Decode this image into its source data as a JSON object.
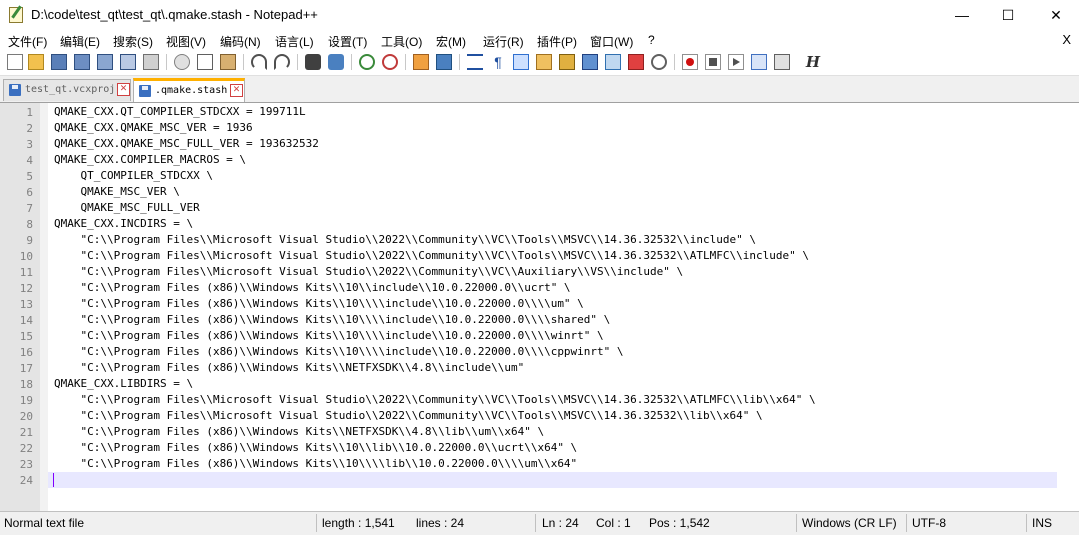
{
  "window": {
    "title": "D:\\code\\test_qt\\test_qt\\.qmake.stash - Notepad++",
    "minimize": "—",
    "maximize": "☐",
    "close": "✕"
  },
  "menu": {
    "items": [
      "文件(F)",
      "编辑(E)",
      "搜索(S)",
      "视图(V)",
      "编码(N)",
      "语言(L)",
      "设置(T)",
      "工具(O)",
      "宏(M)",
      "运行(R)",
      "插件(P)",
      "窗口(W)",
      "?"
    ],
    "close_doc": "X"
  },
  "toolbar": {
    "icons": [
      "new-file-icon",
      "open-file-icon",
      "save-icon",
      "save-all-icon",
      "close-icon",
      "close-all-icon",
      "print-icon",
      "cut-icon",
      "copy-icon",
      "paste-icon",
      "undo-icon",
      "redo-icon",
      "find-icon",
      "replace-icon",
      "zoom-in-icon",
      "zoom-out-icon",
      "sync-vertical-icon",
      "sync-horizontal-icon",
      "word-wrap-icon",
      "show-all-chars-icon",
      "indent-guide-icon",
      "doc-map-icon",
      "function-list-icon",
      "folder-workspace-icon",
      "doc-switcher-icon",
      "monitoring-icon",
      "record-macro-icon",
      "stop-macro-icon",
      "play-macro-icon",
      "run-macro-multiple-icon",
      "save-macro-icon",
      "history-icon"
    ]
  },
  "tabs": [
    {
      "label": "test_qt.vcxproj",
      "active": false
    },
    {
      "label": ".qmake.stash",
      "active": true
    }
  ],
  "editor": {
    "lines": [
      "QMAKE_CXX.QT_COMPILER_STDCXX = 199711L",
      "QMAKE_CXX.QMAKE_MSC_VER = 1936",
      "QMAKE_CXX.QMAKE_MSC_FULL_VER = 193632532",
      "QMAKE_CXX.COMPILER_MACROS = \\",
      "    QT_COMPILER_STDCXX \\",
      "    QMAKE_MSC_VER \\",
      "    QMAKE_MSC_FULL_VER",
      "QMAKE_CXX.INCDIRS = \\",
      "    \"C:\\\\Program Files\\\\Microsoft Visual Studio\\\\2022\\\\Community\\\\VC\\\\Tools\\\\MSVC\\\\14.36.32532\\\\include\" \\",
      "    \"C:\\\\Program Files\\\\Microsoft Visual Studio\\\\2022\\\\Community\\\\VC\\\\Tools\\\\MSVC\\\\14.36.32532\\\\ATLMFC\\\\include\" \\",
      "    \"C:\\\\Program Files\\\\Microsoft Visual Studio\\\\2022\\\\Community\\\\VC\\\\Auxiliary\\\\VS\\\\include\" \\",
      "    \"C:\\\\Program Files (x86)\\\\Windows Kits\\\\10\\\\include\\\\10.0.22000.0\\\\ucrt\" \\",
      "    \"C:\\\\Program Files (x86)\\\\Windows Kits\\\\10\\\\\\\\include\\\\10.0.22000.0\\\\\\\\um\" \\",
      "    \"C:\\\\Program Files (x86)\\\\Windows Kits\\\\10\\\\\\\\include\\\\10.0.22000.0\\\\\\\\shared\" \\",
      "    \"C:\\\\Program Files (x86)\\\\Windows Kits\\\\10\\\\\\\\include\\\\10.0.22000.0\\\\\\\\winrt\" \\",
      "    \"C:\\\\Program Files (x86)\\\\Windows Kits\\\\10\\\\\\\\include\\\\10.0.22000.0\\\\\\\\cppwinrt\" \\",
      "    \"C:\\\\Program Files (x86)\\\\Windows Kits\\\\NETFXSDK\\\\4.8\\\\include\\\\um\"",
      "QMAKE_CXX.LIBDIRS = \\",
      "    \"C:\\\\Program Files\\\\Microsoft Visual Studio\\\\2022\\\\Community\\\\VC\\\\Tools\\\\MSVC\\\\14.36.32532\\\\ATLMFC\\\\lib\\\\x64\" \\",
      "    \"C:\\\\Program Files\\\\Microsoft Visual Studio\\\\2022\\\\Community\\\\VC\\\\Tools\\\\MSVC\\\\14.36.32532\\\\lib\\\\x64\" \\",
      "    \"C:\\\\Program Files (x86)\\\\Windows Kits\\\\NETFXSDK\\\\4.8\\\\lib\\\\um\\\\x64\" \\",
      "    \"C:\\\\Program Files (x86)\\\\Windows Kits\\\\10\\\\lib\\\\10.0.22000.0\\\\ucrt\\\\x64\" \\",
      "    \"C:\\\\Program Files (x86)\\\\Windows Kits\\\\10\\\\\\\\lib\\\\10.0.22000.0\\\\\\\\um\\\\x64\"",
      ""
    ],
    "current_line": 24
  },
  "status": {
    "file_type": "Normal text file",
    "length": "length : 1,541",
    "lines": "lines : 24",
    "ln": "Ln : 24",
    "col": "Col : 1",
    "pos": "Pos : 1,542",
    "eol": "Windows (CR LF)",
    "encoding": "UTF-8",
    "mode": "INS"
  },
  "colors": {
    "current_line": "#e8e8ff",
    "active_tab_accent": "#ffb000",
    "gutter": "#e4e4e4"
  }
}
